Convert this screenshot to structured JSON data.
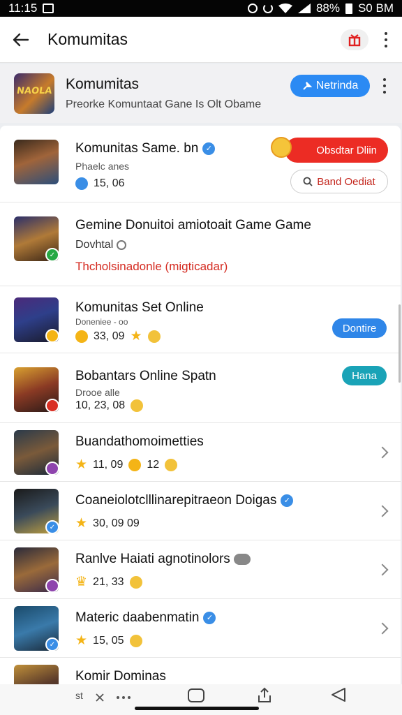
{
  "status_bar": {
    "time": "11:15",
    "battery": "88%",
    "clock_right": "S0 BM"
  },
  "app_bar": {
    "title": "Komumitas"
  },
  "community_header": {
    "name": "Komumitas",
    "subtitle": "Preorke Komuntaat Gane Is Olt Obame",
    "logo_text": "NAOLA",
    "action_label": "Netrinda"
  },
  "rows": [
    {
      "title": "Komunitas Same. bn",
      "subtitle": "Phaelc anes",
      "stat": "15, 06",
      "red_button": "Obsdtar Dliin",
      "outline_button": "Band Oediat"
    },
    {
      "title": "Gemine Donuitoi amiotoait Game Game",
      "subtitle": "Dovhtal",
      "highlight": "Thcholsinadonle (migticadar)"
    },
    {
      "title": "Komunitas Set Online",
      "subtitle": "Doneniee - oo",
      "stat": "33, 09",
      "action": "Dontire"
    },
    {
      "title": "Bobantars Online Spatn",
      "subtitle": "Drooe alle",
      "stat": "10, 23, 08",
      "action": "Hana"
    },
    {
      "title": "Buandathomoimetties",
      "stat": "11, 09",
      "stat2": "12"
    },
    {
      "title": "Coaneiolotclllinarepitraeon Doigas",
      "stat": "30, 09 09"
    },
    {
      "title": "Ranlve Haiati agnotinolors",
      "stat": "21, 33"
    },
    {
      "title": "Materic daabenmatin",
      "stat": "15, 05"
    },
    {
      "title": "Komir Dominas"
    }
  ],
  "nav_bar": {
    "left_label": "st"
  },
  "colors": {
    "accent_blue": "#2b8af3",
    "accent_red": "#ec2c24",
    "teal": "#1aa3b7",
    "star": "#f4b416"
  }
}
